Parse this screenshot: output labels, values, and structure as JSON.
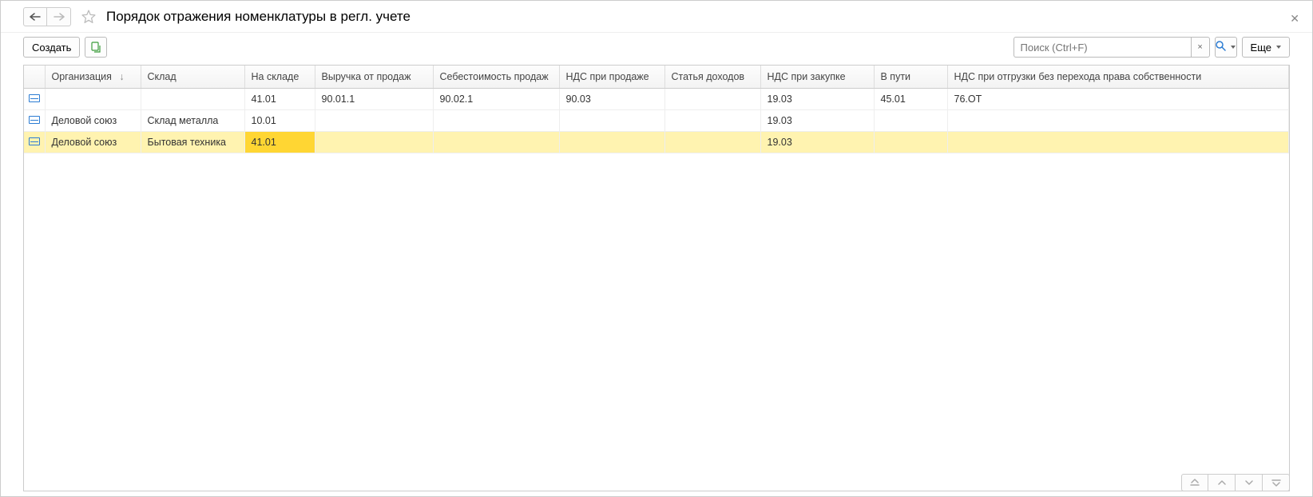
{
  "header": {
    "title": "Порядок отражения номенклатуры в регл. учете"
  },
  "toolbar": {
    "create_label": "Создать",
    "more_label": "Еще"
  },
  "search": {
    "placeholder": "Поиск (Ctrl+F)"
  },
  "table": {
    "columns": [
      "Организация",
      "Склад",
      "На складе",
      "Выручка от продаж",
      "Себестоимость продаж",
      "НДС при продаже",
      "Статья доходов",
      "НДС при закупке",
      "В пути",
      "НДС при отгрузки без перехода права собственности"
    ],
    "rows": [
      {
        "org": "",
        "warehouse": "",
        "on_stock": "41.01",
        "revenue": "90.01.1",
        "cost": "90.02.1",
        "vat_sale": "90.03",
        "income_item": "",
        "vat_purchase": "19.03",
        "in_transit": "45.01",
        "vat_ship": "76.ОТ",
        "selected": false
      },
      {
        "org": "Деловой союз",
        "warehouse": "Склад металла",
        "on_stock": "10.01",
        "revenue": "",
        "cost": "",
        "vat_sale": "",
        "income_item": "",
        "vat_purchase": "19.03",
        "in_transit": "",
        "vat_ship": "",
        "selected": false
      },
      {
        "org": "Деловой союз",
        "warehouse": "Бытовая техника",
        "on_stock": "41.01",
        "revenue": "",
        "cost": "",
        "vat_sale": "",
        "income_item": "",
        "vat_purchase": "19.03",
        "in_transit": "",
        "vat_ship": "",
        "selected": true
      }
    ]
  }
}
